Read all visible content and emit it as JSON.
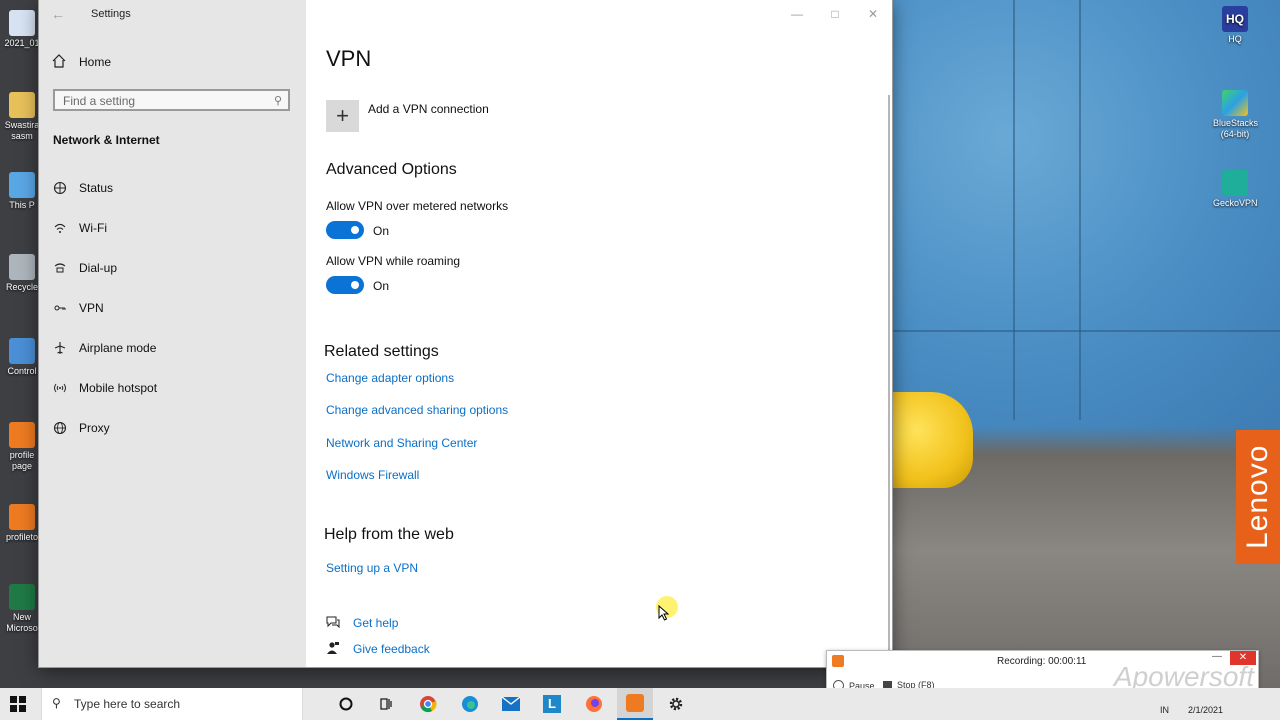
{
  "window": {
    "title": "Settings",
    "controls": [
      "—",
      "□",
      "✕"
    ]
  },
  "sidebar": {
    "home": "Home",
    "search_placeholder": "Find a setting",
    "section": "Network & Internet",
    "items": [
      {
        "label": "Status",
        "icon": "status-globe-icon"
      },
      {
        "label": "Wi-Fi",
        "icon": "wifi-icon"
      },
      {
        "label": "Dial-up",
        "icon": "dialup-icon"
      },
      {
        "label": "VPN",
        "icon": "vpn-icon"
      },
      {
        "label": "Airplane mode",
        "icon": "airplane-icon"
      },
      {
        "label": "Mobile hotspot",
        "icon": "hotspot-icon"
      },
      {
        "label": "Proxy",
        "icon": "globe-icon"
      }
    ]
  },
  "main": {
    "title": "VPN",
    "add_vpn": "Add a VPN connection",
    "advanced_heading": "Advanced Options",
    "opt_metered": "Allow VPN over metered networks",
    "opt_metered_state": "On",
    "opt_roaming": "Allow VPN while roaming",
    "opt_roaming_state": "On",
    "related_heading": "Related settings",
    "related_links": [
      "Change adapter options",
      "Change advanced sharing options",
      "Network and Sharing Center",
      "Windows Firewall"
    ],
    "help_heading": "Help from the web",
    "help_link": "Setting up a VPN",
    "get_help": "Get help",
    "give_feedback": "Give feedback"
  },
  "desktop_icons": {
    "left": [
      "2021_01",
      "Swastira sasm",
      "This P",
      "Recycle",
      "Control",
      "profile page",
      "profileto",
      "New Microso"
    ],
    "right": [
      "HQ",
      "BlueStacks (64-bit)",
      "GeckoVPN"
    ]
  },
  "recorder": {
    "status": "Recording:   00:00:11",
    "pause": "Pause",
    "stop": "Stop (F8)",
    "watermark": "Apowersoft"
  },
  "taskbar": {
    "search_placeholder": "Type here to search",
    "lang": "IN",
    "date": "2/1/2021",
    "apps": [
      "cortana-icon",
      "task-view-icon",
      "chrome-icon",
      "edge-icon",
      "mail-icon",
      "l-app-icon",
      "firefox-icon",
      "recorder-icon",
      "settings-gear-icon"
    ]
  },
  "colors": {
    "accent": "#0b72d6",
    "link": "#0b6fc7",
    "nav_bg": "#e6e6e6",
    "lenovo": "#e8611b"
  }
}
